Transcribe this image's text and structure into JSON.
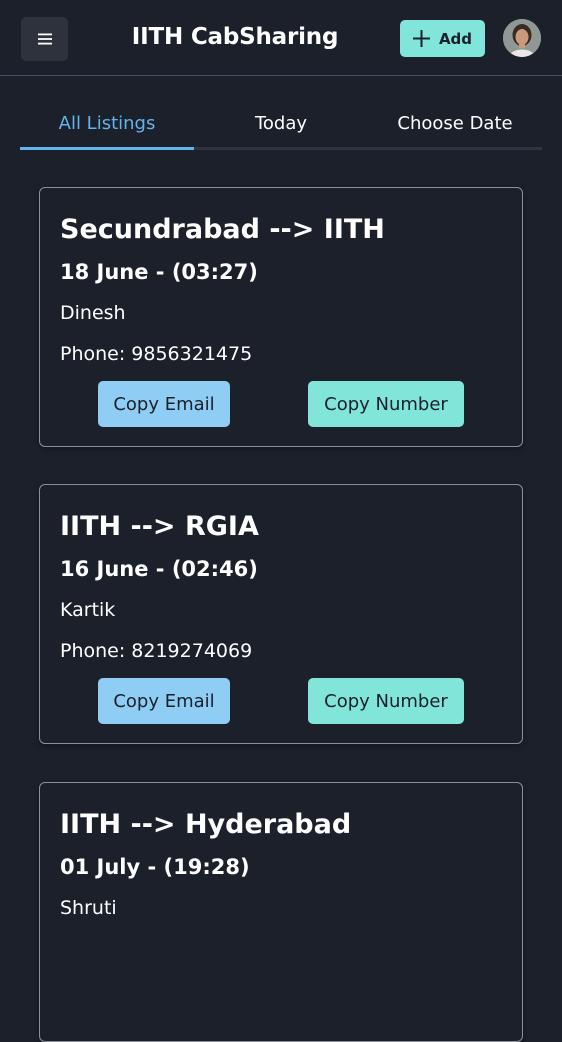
{
  "header": {
    "title": "IITH CabSharing",
    "add_label": "Add"
  },
  "tabs": [
    {
      "label": "All Listings",
      "active": true
    },
    {
      "label": "Today",
      "active": false
    },
    {
      "label": "Choose Date",
      "active": false
    }
  ],
  "listings": [
    {
      "route": "Secundrabad --> IITH",
      "when": "18 June - (03:27)",
      "name": "Dinesh",
      "phone": "Phone: 9856321475",
      "email_label": "Copy Email",
      "number_label": "Copy Number"
    },
    {
      "route": "IITH --> RGIA",
      "when": "16 June - (02:46)",
      "name": "Kartik",
      "phone": "Phone: 8219274069",
      "email_label": "Copy Email",
      "number_label": "Copy Number"
    },
    {
      "route": "IITH --> Hyderabad",
      "when": "01 July - (19:28)",
      "name": "Shruti",
      "phone": "",
      "email_label": "",
      "number_label": ""
    }
  ],
  "colors": {
    "background": "#1b202b",
    "accent_teal": "#81e6d9",
    "accent_blue": "#90cdf4",
    "tab_active": "#63b3ed"
  },
  "icons": {
    "menu": "hamburger-icon",
    "add": "plus-icon",
    "avatar": "user-avatar"
  }
}
